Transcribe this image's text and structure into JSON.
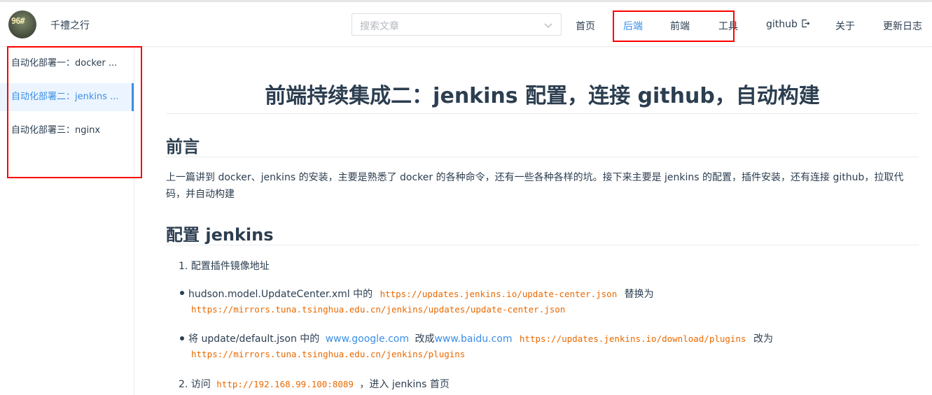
{
  "header": {
    "avatar_text": "96#",
    "site_title": "千禮之行",
    "search_placeholder": "搜索文章",
    "nav": [
      {
        "label": "首页"
      },
      {
        "label": "后端"
      },
      {
        "label": "前端"
      },
      {
        "label": "工具"
      },
      {
        "label": "github"
      },
      {
        "label": "关于"
      },
      {
        "label": "更新日志"
      }
    ],
    "accent_color": "#3a8ee6"
  },
  "sidebar": {
    "items": [
      {
        "label": "自动化部署一：docker ..."
      },
      {
        "label": "自动化部署二：jenkins ..."
      },
      {
        "label": "自动化部署三：nginx"
      }
    ]
  },
  "article": {
    "title": "前端持续集成二：jenkins 配置，连接 github，自动构建",
    "section1_title": "前言",
    "intro": "上一篇讲到 docker、jenkins 的安装，主要是熟悉了 docker 的各种命令，还有一些各种各样的坑。接下来主要是 jenkins 的配置，插件安装，还有连接 github，拉取代码，并自动构建",
    "section2_title": "配置 jenkins",
    "step1": "1. 配置插件镜像地址",
    "b1_text": "hudson.model.UpdateCenter.xml 中的",
    "b1_code1": "https://updates.jenkins.io/update-center.json",
    "b1_mid": "替换为",
    "b1_code2": "https://mirrors.tuna.tsinghua.edu.cn/jenkins/updates/update-center.json",
    "b2_text": "将 update/default.json 中的",
    "b2_link1": "www.google.com",
    "b2_mid": "改成",
    "b2_link2": "www.baidu.com",
    "b2_code1": "https://updates.jenkins.io/download/plugins",
    "b2_end": "改为",
    "b2_code2": "https://mirrors.tuna.tsinghua.edu.cn/jenkins/plugins",
    "step2_prefix": "2. 访问",
    "step2_code": "http://192.168.99.100:8089",
    "step2_suffix": "，进入 jenkins 首页"
  }
}
